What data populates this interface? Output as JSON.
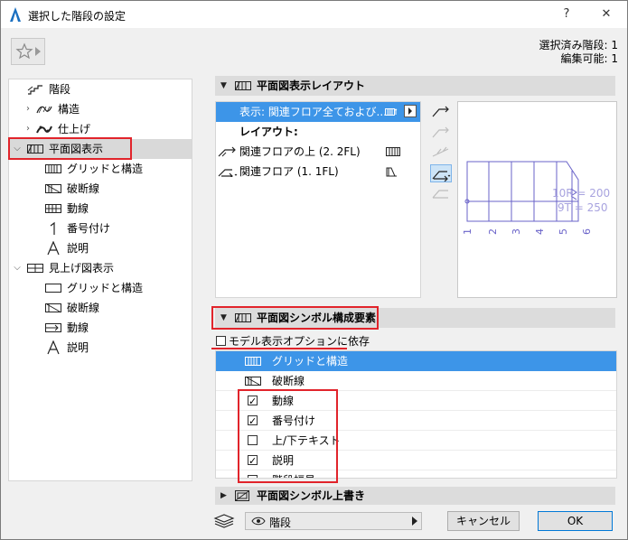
{
  "window": {
    "title": "選択した階段の設定",
    "help_label": "?",
    "close_label": "✕"
  },
  "status": {
    "selected_line": "選択済み階段: 1",
    "editable_line": "編集可能: 1"
  },
  "tree": {
    "items": [
      {
        "label": "階段"
      },
      {
        "label": "構造"
      },
      {
        "label": "仕上げ"
      },
      {
        "label": "平面図表示"
      },
      {
        "label": "グリッドと構造"
      },
      {
        "label": "破断線"
      },
      {
        "label": "動線"
      },
      {
        "label": "番号付け"
      },
      {
        "label": "説明"
      },
      {
        "label": "見上げ図表示"
      },
      {
        "label": "グリッドと構造"
      },
      {
        "label": "破断線"
      },
      {
        "label": "動線"
      },
      {
        "label": "説明"
      }
    ]
  },
  "layout_panel": {
    "header": "平面図表示レイアウト",
    "display_value": "表示: 関連フロア全ておよび...",
    "layout_heading": "レイアウト:",
    "rows": [
      {
        "label": "関連フロアの上 (2. 2FL)"
      },
      {
        "label": "関連フロア (1. 1FL)"
      }
    ]
  },
  "preview": {
    "step_numbers": [
      "1",
      "2",
      "3",
      "4",
      "5",
      "6"
    ],
    "riser_label": "10R = 200",
    "tread_label": "9T = 250"
  },
  "symbol_panel": {
    "header": "平面図シンボル構成要素",
    "depend_label": "モデル表示オプションに依存",
    "depend_checked": false,
    "rows": [
      {
        "label": "グリッドと構造",
        "checkbox": false,
        "checked": false,
        "selected": true
      },
      {
        "label": "破断線",
        "checkbox": false,
        "checked": false,
        "selected": false
      },
      {
        "label": "動線",
        "checkbox": true,
        "checked": true,
        "selected": false
      },
      {
        "label": "番号付け",
        "checkbox": true,
        "checked": true,
        "selected": false
      },
      {
        "label": "上/下テキスト",
        "checkbox": true,
        "checked": false,
        "selected": false
      },
      {
        "label": "説明",
        "checkbox": true,
        "checked": true,
        "selected": false
      },
      {
        "label": "階段幅員",
        "checkbox": true,
        "checked": false,
        "selected": false
      }
    ]
  },
  "override_panel": {
    "header": "平面図シンボル上書き"
  },
  "footer": {
    "combo_value": "階段",
    "cancel_label": "キャンセル",
    "ok_label": "OK"
  },
  "colors": {
    "selection": "#3d95e8",
    "highlight": "#e1242b",
    "preview_lines": "#6a63c9"
  }
}
